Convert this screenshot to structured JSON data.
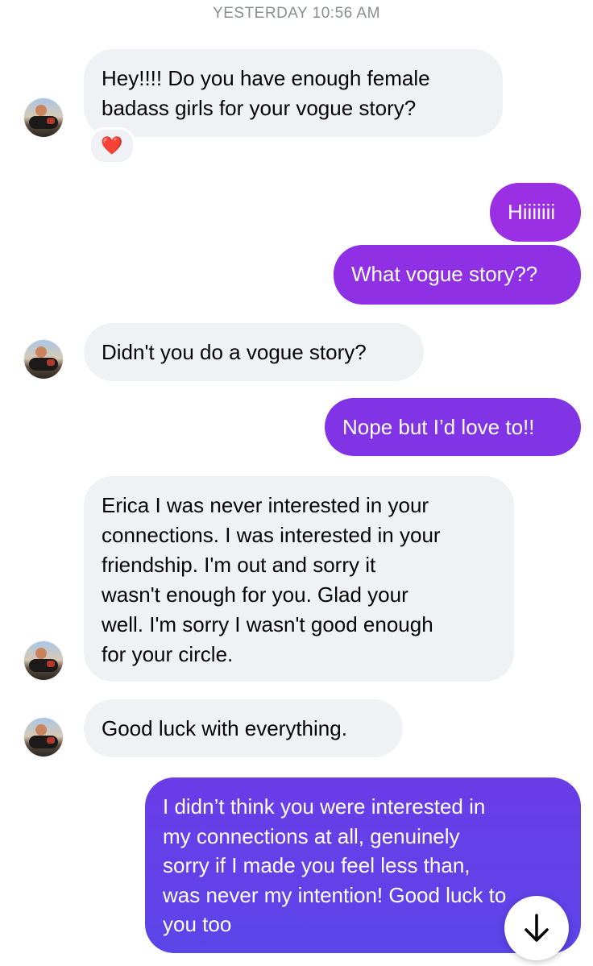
{
  "thread": {
    "timestamp": "YESTERDAY 10:56 AM",
    "reaction_emoji": "❤️",
    "messages": [
      {
        "from": "them",
        "text": "Hey!!!!  Do you have enough female\nbadass girls for your vogue story?"
      },
      {
        "from": "me",
        "text": "Hiiiiiii"
      },
      {
        "from": "me",
        "text": "What vogue story??"
      },
      {
        "from": "them",
        "text": "Didn't you do a vogue story?"
      },
      {
        "from": "me",
        "text": "Nope but I’d love to!!"
      },
      {
        "from": "them",
        "text": "Erica I was never interested in your\nconnections. I was interested in your\nfriendship.  I'm out and sorry it\nwasn't enough for you.  Glad your\nwell. I'm sorry I wasn't good enough\nfor your circle."
      },
      {
        "from": "them",
        "text": "Good luck with everything."
      },
      {
        "from": "me",
        "text": "I didn’t think you were interested in\nmy connections at all, genuinely\nsorry if I made you feel less than,\nwas never my intention! Good luck to\nyou too"
      }
    ]
  },
  "colors": {
    "incoming_bg": "#eff1f4",
    "outgoing_purple": "#9b2fe3",
    "outgoing_blue": "#5b45e9"
  },
  "icons": {
    "scroll_down": "arrow-down-icon",
    "reaction": "heart-icon"
  }
}
